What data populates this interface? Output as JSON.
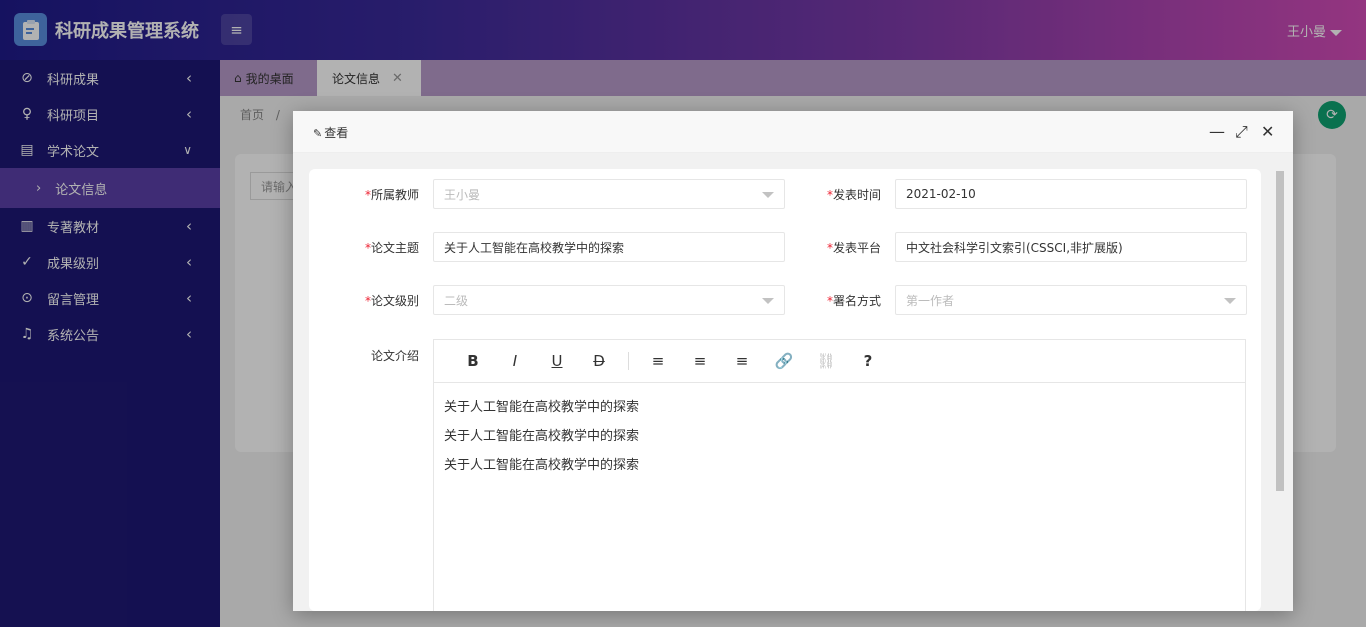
{
  "app": {
    "title": "科研成果管理系统",
    "user": "王小曼"
  },
  "sidebar": {
    "items": [
      {
        "label": "科研成果",
        "icon": "compass-icon"
      },
      {
        "label": "科研项目",
        "icon": "lightbulb-icon"
      },
      {
        "label": "学术论文",
        "icon": "document-icon",
        "expanded": true
      },
      {
        "label": "专著教材",
        "icon": "book-icon"
      },
      {
        "label": "成果级别",
        "icon": "check-icon"
      },
      {
        "label": "留言管理",
        "icon": "message-icon"
      },
      {
        "label": "系统公告",
        "icon": "bell-icon"
      }
    ],
    "sub_item": "论文信息"
  },
  "tabs": {
    "home": "我的桌面",
    "active": "论文信息"
  },
  "breadcrumb": {
    "home": "首页",
    "sep": "/"
  },
  "search": {
    "placeholder": "请输入"
  },
  "modal": {
    "title": "查看",
    "fields": {
      "teacher": {
        "label": "所属教师",
        "value": "王小曼"
      },
      "publish_time": {
        "label": "发表时间",
        "value": "2021-02-10"
      },
      "topic": {
        "label": "论文主题",
        "value": "关于人工智能在高校教学中的探索"
      },
      "platform": {
        "label": "发表平台",
        "value": "中文社会科学引文索引(CSSCI,非扩展版)"
      },
      "level": {
        "label": "论文级别",
        "value": "二级"
      },
      "signature": {
        "label": "署名方式",
        "value": "第一作者"
      },
      "intro": {
        "label": "论文介绍"
      }
    },
    "editor": {
      "toolbar": [
        "B",
        "I",
        "U",
        "D",
        "≡",
        "≡",
        "≡",
        "🔗",
        "⛓",
        "?"
      ],
      "lines": [
        "关于人工智能在高校教学中的探索",
        "关于人工智能在高校教学中的探索",
        "关于人工智能在高校教学中的探索"
      ]
    }
  },
  "colors": {
    "sidebar": "#1e1874",
    "accent": "#5b40a8",
    "required": "#e22233",
    "refresh": "#0fa372"
  }
}
